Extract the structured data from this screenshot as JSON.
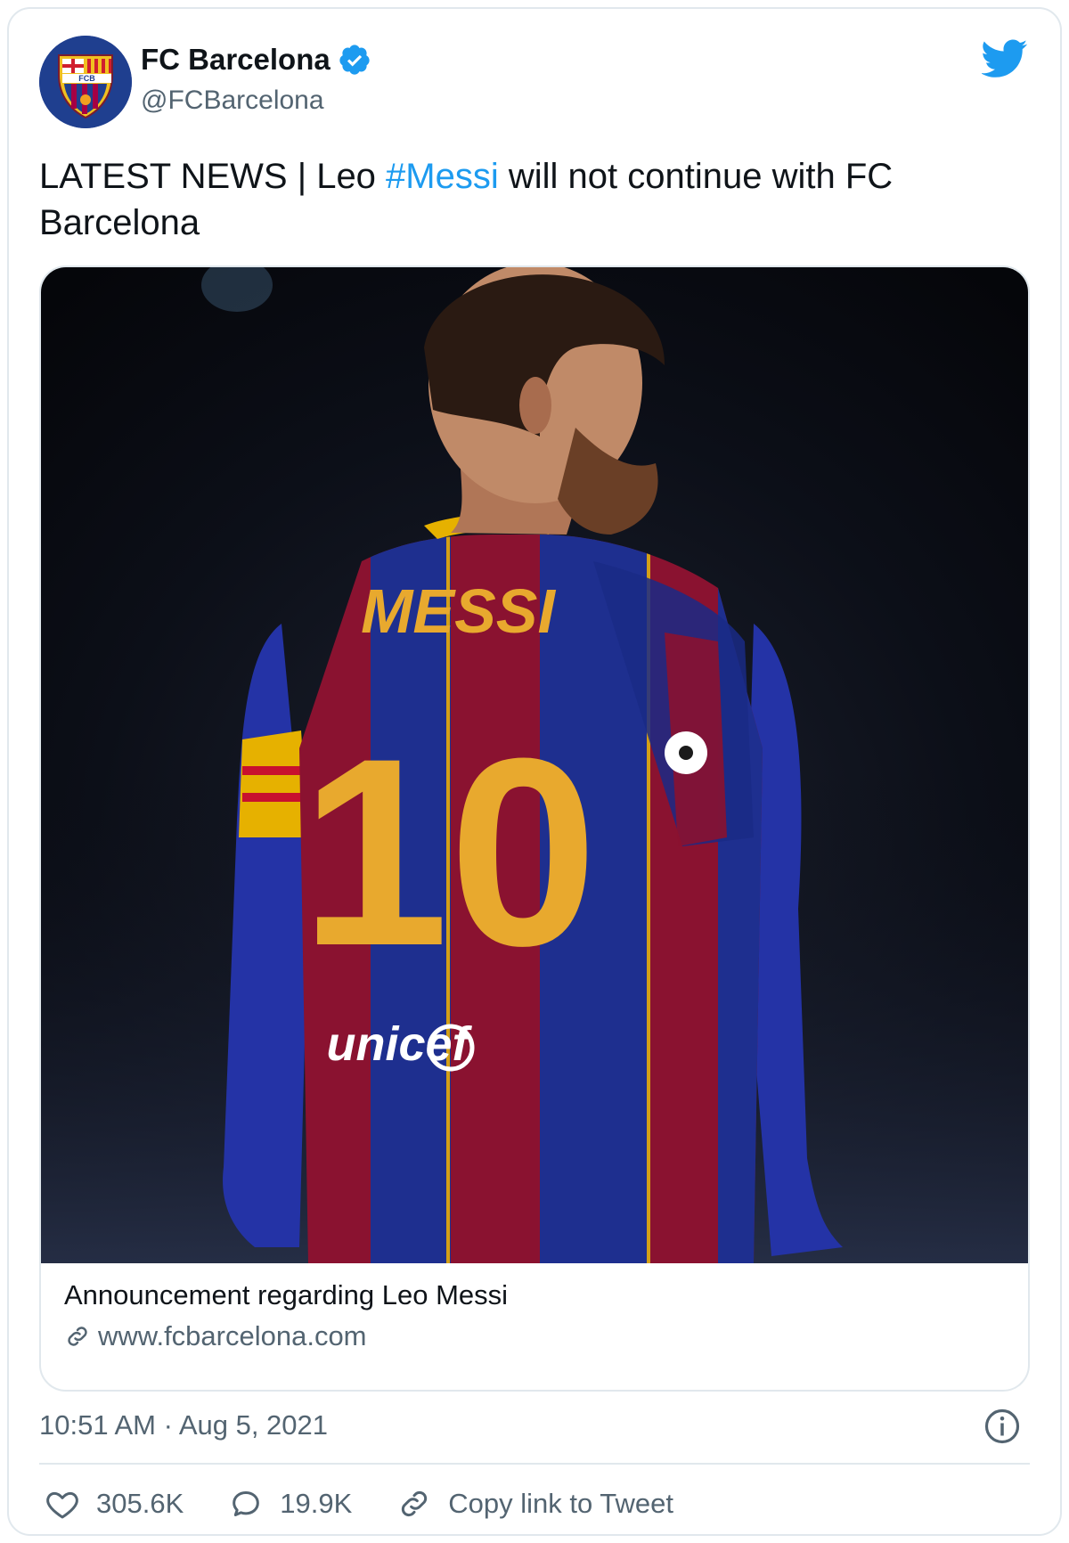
{
  "account": {
    "display_name": "FC Barcelona",
    "handle": "@FCBarcelona",
    "verified": true,
    "avatar_text": "FCB"
  },
  "tweet": {
    "text_before": "LATEST NEWS | Leo ",
    "hashtag": "#Messi",
    "text_after": " will not continue with FC Barcelona"
  },
  "media": {
    "jersey_name": "MESSI",
    "jersey_number": "10",
    "sponsor": "unicef"
  },
  "link_card": {
    "title": "Announcement regarding Leo Messi",
    "domain": "www.fcbarcelona.com",
    "icon": "link-icon"
  },
  "meta": {
    "timestamp": "10:51 AM · Aug 5, 2021",
    "info_icon": "info-icon"
  },
  "actions": {
    "likes_count": "305.6K",
    "replies_count": "19.9K",
    "copy_link_label": "Copy link to Tweet"
  },
  "colors": {
    "accent": "#1d9bf0",
    "text": "#0f1419",
    "secondary_text": "#536471",
    "border": "#e1e8ed"
  }
}
